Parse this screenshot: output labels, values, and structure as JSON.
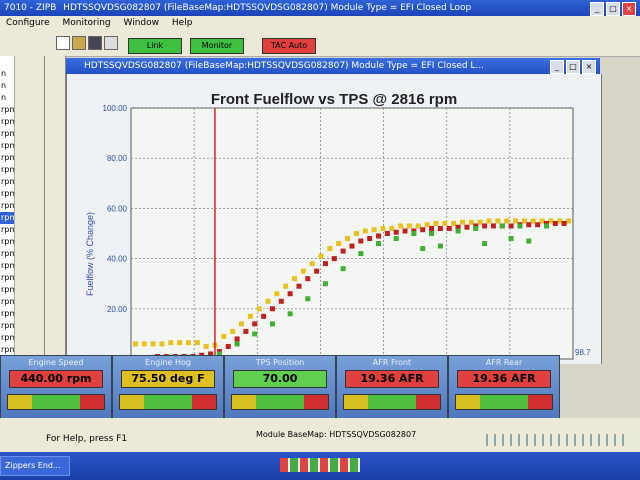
{
  "outer_window": {
    "title": "HDTSSQVDSG082807       (FileBaseMap:HDTSSQVDSG082807) Module Type = EFI Closed Loop",
    "left_fragment": "7010 - ZIPB"
  },
  "menu": [
    "Configure",
    "Monitoring",
    "Window",
    "Help"
  ],
  "toolbar": {
    "status_buttons": [
      {
        "label": "Link",
        "color": "#3fbf3f"
      },
      {
        "label": "Monitor",
        "color": "#3fbf3f"
      },
      {
        "label": "TAC Auto",
        "color": "#e04040"
      }
    ]
  },
  "sidebar": {
    "items": [
      "",
      "n",
      "n",
      "n",
      "rpm",
      "rpm",
      "rpm",
      "rpm",
      "rpm",
      "rpm",
      "rpm",
      "rpm",
      "rpm",
      "rpm",
      "rpm",
      "rpm",
      "rpm",
      "rpm",
      "rpm",
      "rpm",
      "rpm",
      "rpm",
      "rpm",
      "rpm",
      "rpm",
      "rpm"
    ],
    "selected_index": 13
  },
  "inner_window": {
    "title": "HDTSSQVDSG082807       (FileBaseMap:HDTSSQVDSG082807) Module Type = EFI Closed L..."
  },
  "chart_data": {
    "type": "scatter",
    "title": "Front Fuelflow vs TPS @ 2816 rpm",
    "ylabel": "Fuelflow (% Change)",
    "xlabel": "",
    "ylim": [
      0,
      100
    ],
    "xlim": [
      0,
      100
    ],
    "y_ticks": [
      "100.00",
      "80.00",
      "60.00",
      "40.00",
      "20.00"
    ],
    "x_tick_right": "98.7",
    "grid": true,
    "cursor_x": 19,
    "series": [
      {
        "color": "#e8c020",
        "x": [
          1,
          3,
          5,
          7,
          9,
          11,
          13,
          15,
          17,
          19,
          21,
          23,
          25,
          27,
          29,
          31,
          33,
          35,
          37,
          39,
          41,
          43,
          45,
          47,
          49,
          51,
          53,
          55,
          57,
          59,
          61,
          63,
          65,
          67,
          69,
          71,
          73,
          75,
          77,
          79,
          81,
          83,
          85,
          87,
          89,
          91,
          93,
          95,
          97,
          99
        ],
        "y": [
          6,
          6,
          6,
          6,
          6.5,
          6.5,
          6.5,
          6.5,
          5,
          5.5,
          9,
          11,
          14,
          17,
          20,
          23,
          26,
          29,
          32,
          35,
          38,
          41,
          44,
          46,
          48,
          50,
          51,
          51.5,
          52,
          52,
          53,
          53,
          53,
          53.5,
          54,
          54,
          54,
          54.5,
          54.5,
          54.5,
          55,
          55,
          55,
          55,
          55,
          55,
          55,
          55,
          55,
          55
        ]
      },
      {
        "color": "#c02020",
        "x": [
          2,
          4,
          6,
          8,
          10,
          12,
          14,
          16,
          18,
          20,
          22,
          24,
          26,
          28,
          30,
          32,
          34,
          36,
          38,
          40,
          42,
          44,
          46,
          48,
          50,
          52,
          54,
          56,
          58,
          60,
          62,
          64,
          66,
          68,
          70,
          72,
          74,
          76,
          78,
          80,
          82,
          84,
          86,
          88,
          90,
          92,
          94,
          96,
          98
        ],
        "y": [
          0.5,
          0.5,
          1,
          1,
          1,
          1,
          1,
          1.5,
          2,
          3,
          5,
          8,
          11,
          14,
          17,
          20,
          23,
          26,
          29,
          32,
          35,
          38,
          40,
          43,
          45,
          47,
          48,
          49,
          50,
          50.5,
          51,
          51,
          51.5,
          52,
          52,
          52,
          52.5,
          52.5,
          53,
          53,
          53,
          53,
          53,
          53.5,
          53.5,
          53.5,
          54,
          54,
          54
        ]
      },
      {
        "color": "#40b030",
        "x": [
          20,
          24,
          28,
          32,
          36,
          40,
          44,
          48,
          52,
          56,
          60,
          64,
          66,
          68,
          70,
          74,
          78,
          80,
          84,
          86,
          88,
          90,
          94
        ],
        "y": [
          2,
          6,
          10,
          14,
          18,
          24,
          30,
          36,
          42,
          46,
          48,
          50,
          44,
          50,
          45,
          51,
          52,
          46,
          53,
          48,
          53,
          47,
          53
        ]
      }
    ]
  },
  "gauges": [
    {
      "label": "Engine Speed",
      "value": "440.00  rpm",
      "value_bg": "#e04040",
      "bar": [
        "#d8c020",
        "#4fbf3f",
        "#d03030"
      ],
      "bar_split": [
        0.25,
        0.5,
        0.25
      ]
    },
    {
      "label": "Engine Hog",
      "value": "75.50  deg F",
      "value_bg": "#e0c020",
      "bar": [
        "#d8c020",
        "#4fbf3f",
        "#d03030"
      ],
      "bar_split": [
        0.25,
        0.5,
        0.25
      ]
    },
    {
      "label": "TPS Position",
      "value": "70.00",
      "value_bg": "#5fcf4f",
      "bar": [
        "#d8c020",
        "#4fbf3f",
        "#d03030"
      ],
      "bar_split": [
        0.25,
        0.5,
        0.25
      ]
    },
    {
      "label": "AFR Front",
      "value": "19.36  AFR",
      "value_bg": "#e04040",
      "bar": [
        "#d8c020",
        "#4fbf3f",
        "#d03030"
      ],
      "bar_split": [
        0.25,
        0.5,
        0.25
      ]
    },
    {
      "label": "AFR Rear",
      "value": "19.36  AFR",
      "value_bg": "#e04040",
      "bar": [
        "#d8c020",
        "#4fbf3f",
        "#d03030"
      ],
      "bar_split": [
        0.25,
        0.5,
        0.25
      ]
    }
  ],
  "status_bar": {
    "help_text": "For Help, press F1",
    "module_text": "Module BaseMap: HDTSSQVDSG082807"
  },
  "taskbar": {
    "item": "Zippers End..."
  }
}
